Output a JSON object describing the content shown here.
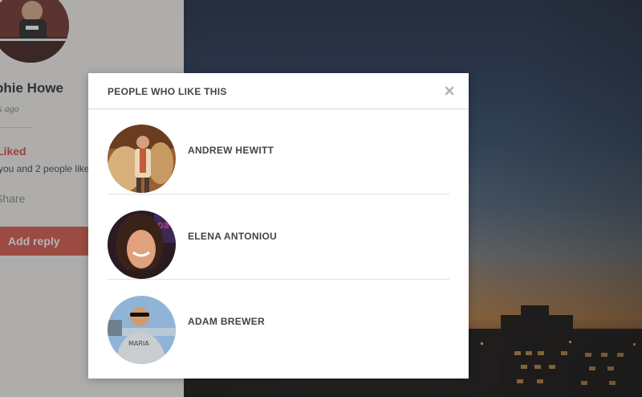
{
  "post": {
    "author_name": "phie Howe",
    "time_ago": "s ago",
    "liked_label": "Liked",
    "like_summary": "you and 2 people like",
    "share_label": "Share",
    "add_reply_label": "Add reply"
  },
  "modal": {
    "title": "PEOPLE WHO LIKE THIS",
    "close_icon": "close-icon",
    "people": [
      {
        "name": "ANDREW HEWITT"
      },
      {
        "name": "ELENA ANTONIOU"
      },
      {
        "name": "ADAM BREWER"
      }
    ]
  },
  "colors": {
    "accent_red": "#d65446",
    "liked_red": "#d9463c",
    "text_dark": "#444444"
  }
}
